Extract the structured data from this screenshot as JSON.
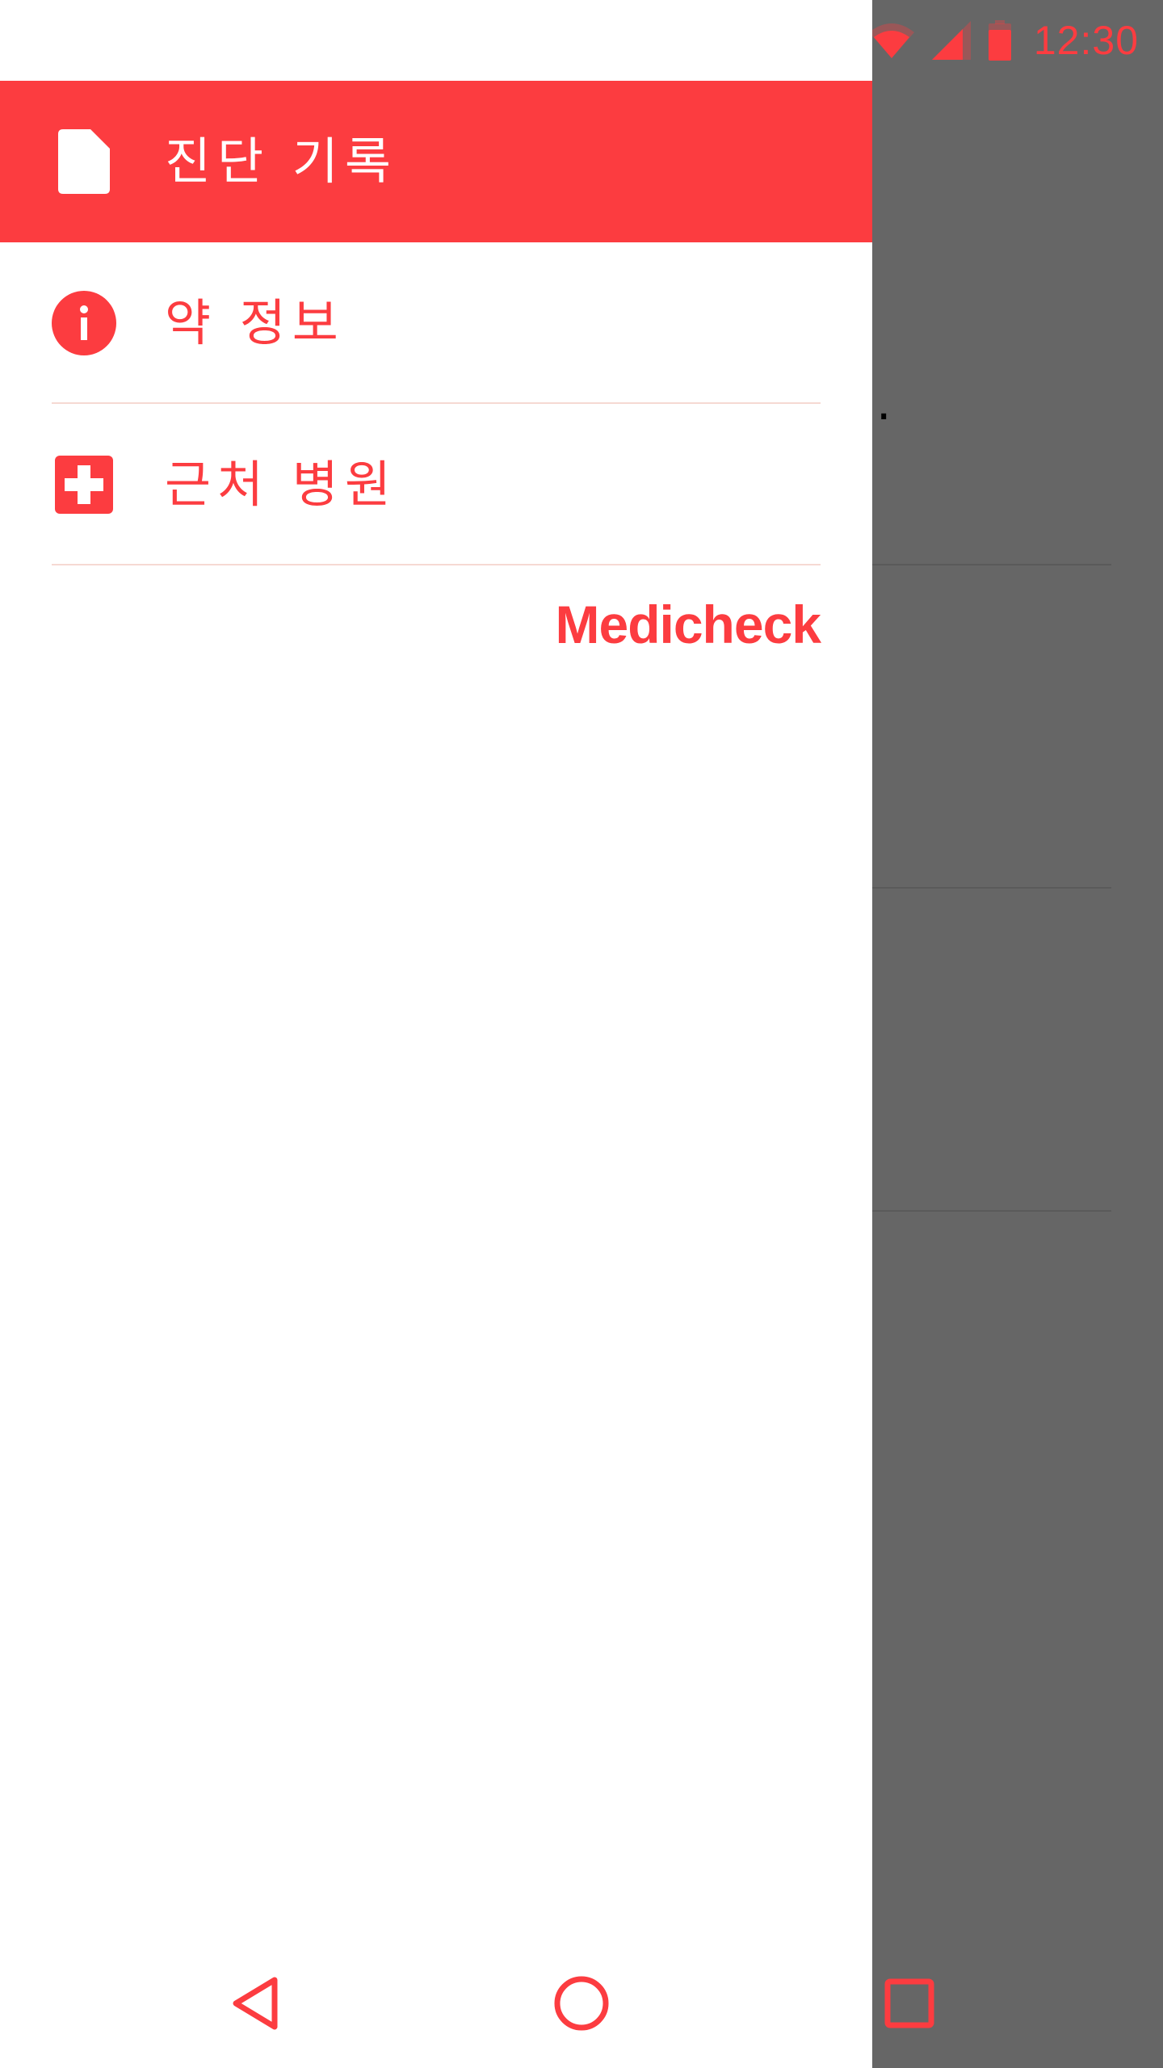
{
  "status_bar": {
    "time": "12:30",
    "icons": [
      "wifi-icon",
      "cell-signal-icon",
      "battery-icon"
    ]
  },
  "drawer": {
    "items": [
      {
        "label": "진단 기록",
        "icon": "document-icon",
        "active": true
      },
      {
        "label": "약 정보",
        "icon": "info-icon",
        "active": false
      },
      {
        "label": "근처 병원",
        "icon": "hospital-cross-icon",
        "active": false
      }
    ],
    "brand": "Medicheck"
  },
  "background": {
    "partial_text": "."
  },
  "nav_bar": {
    "buttons": [
      "back-icon",
      "home-icon",
      "recents-icon"
    ]
  },
  "colors": {
    "accent": "#fc3c40",
    "divider": "#f6d9d3",
    "scrim": "rgba(0,0,0,0.6)"
  }
}
